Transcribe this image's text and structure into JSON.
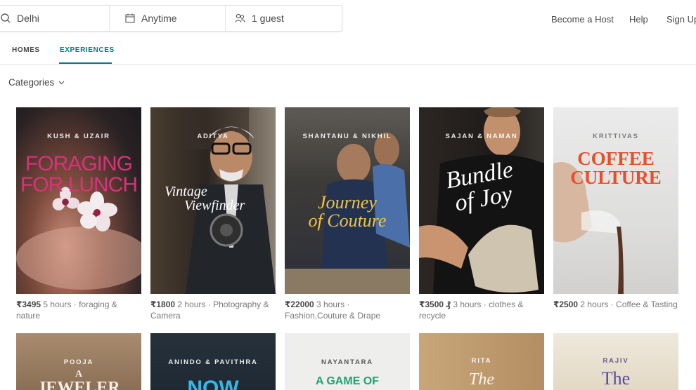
{
  "search": {
    "where": "Delhi",
    "when": "Anytime",
    "guests": "1 guest"
  },
  "nav": {
    "become_host": "Become a Host",
    "help": "Help",
    "sign_up": "Sign Up"
  },
  "tabs": [
    {
      "label": "HOMES"
    },
    {
      "label": "EXPERIENCES"
    }
  ],
  "filters": {
    "categories_label": "Categories"
  },
  "experiences_row1": [
    {
      "host": "KUSH & UZAIR",
      "title_lines": [
        "FORAGING",
        "FOR LUNCH"
      ],
      "price": "₹3495",
      "details": " 5 hours · foraging & nature"
    },
    {
      "host": "ADITYA",
      "title_lines": [
        "Vintage",
        "Viewfinder"
      ],
      "price": "₹1800",
      "details": " 2 hours · Photography & Camera"
    },
    {
      "host": "SHANTANU & NIKHIL",
      "title_lines": [
        "Journey",
        "of Couture"
      ],
      "price": "₹22000",
      "details": " 3 hours · Fashion,Couture & Drape"
    },
    {
      "host": "SAJAN & NAMAN",
      "title_lines": [
        "Bundle",
        "of Joy"
      ],
      "price": "₹3500 ₰",
      "details": " 3 hours · clothes & recycle"
    },
    {
      "host": "KRITTIVAS",
      "title_lines": [
        "COFFEE",
        "CULTURE"
      ],
      "price": "₹2500",
      "details": " 2 hours · Coffee & Tasting"
    }
  ],
  "experiences_row2": [
    {
      "host": "POOJA",
      "title_lines": [
        "A",
        "JEWELER"
      ]
    },
    {
      "host": "ANINDO & PAVITHRA",
      "title_lines": [
        "NOW"
      ]
    },
    {
      "host": "NAYANTARA",
      "title_lines": [
        "A GAME OF"
      ]
    },
    {
      "host": "RITA",
      "title_lines": [
        "The"
      ]
    },
    {
      "host": "RAJIV",
      "title_lines": [
        "The"
      ]
    }
  ],
  "colors": {
    "accent": "#007a87",
    "text": "#484848",
    "muted": "#7a7a7a"
  }
}
